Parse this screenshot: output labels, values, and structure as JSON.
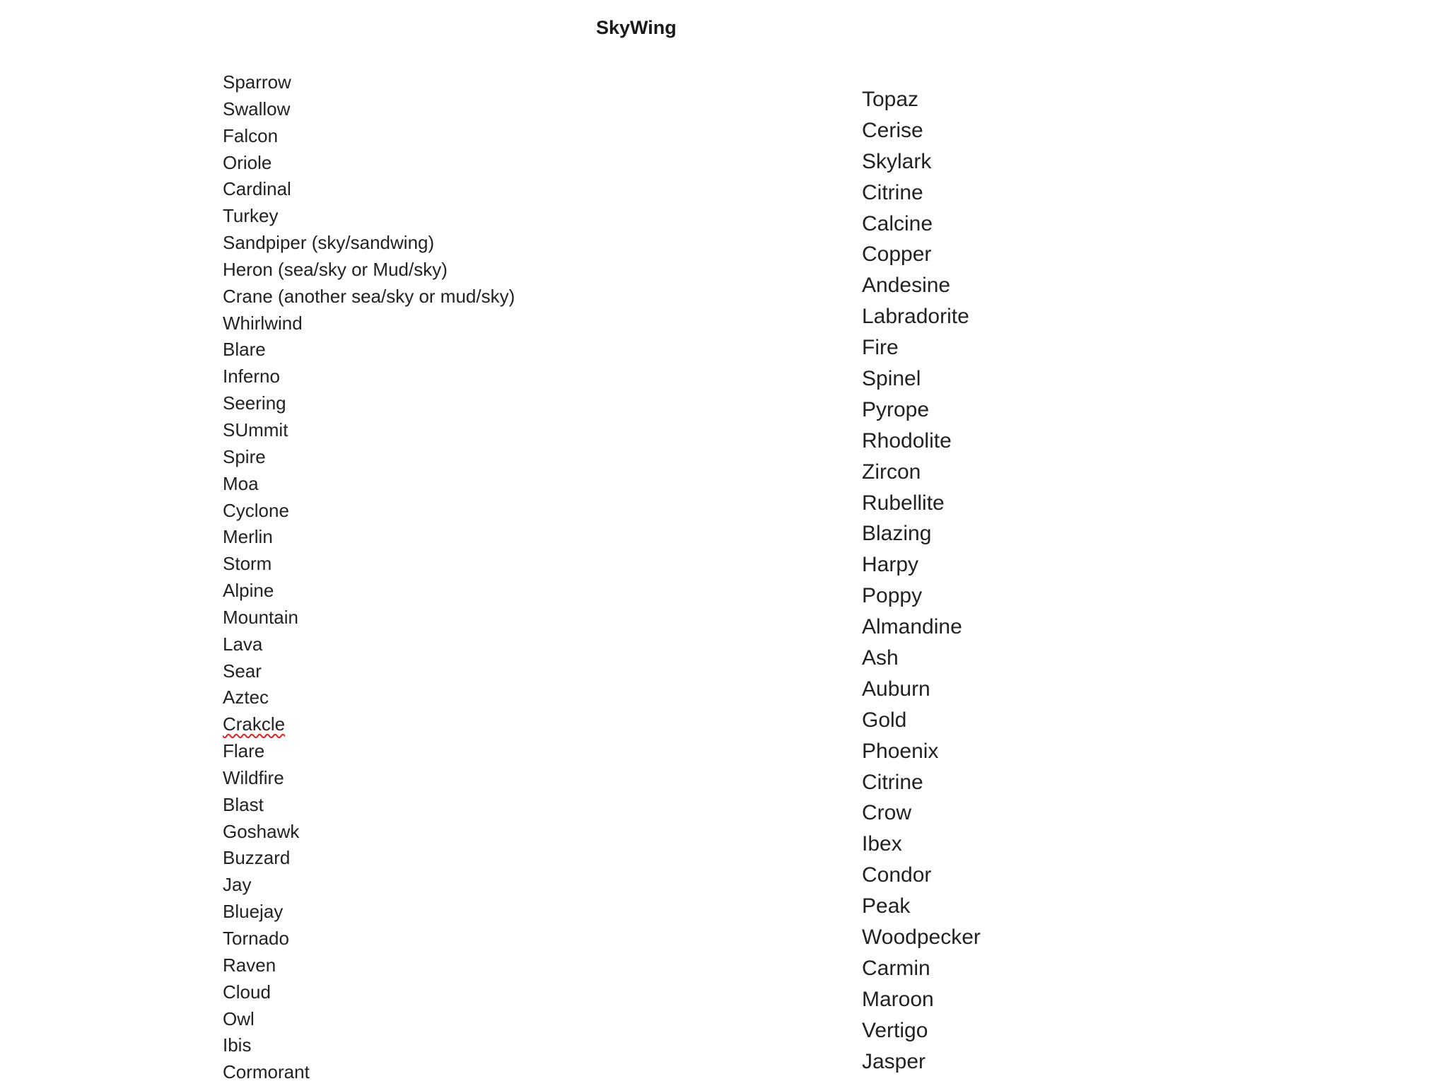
{
  "document": {
    "title": "SkyWing",
    "left_column": [
      "Sparrow",
      "Swallow",
      "Falcon",
      "Oriole",
      "Cardinal",
      "Turkey",
      "Sandpiper (sky/sandwing)",
      "Heron (sea/sky or Mud/sky)",
      "Crane (another sea/sky or mud/sky)",
      "Whirlwind",
      "Blare",
      "Inferno",
      "Seering",
      "SUmmit",
      "Spire",
      "Moa",
      "Cyclone",
      "Merlin",
      "Storm",
      "Alpine",
      "Mountain",
      "Lava",
      "Sear",
      "Aztec",
      "Crakcle",
      "Flare",
      "Wildfire",
      "Blast",
      "Goshawk",
      "Buzzard",
      "Jay",
      "Bluejay",
      "Tornado",
      "Raven",
      "Cloud",
      "Owl",
      "Ibis",
      "Cormorant"
    ],
    "right_column": [
      "Topaz",
      "Cerise",
      "Skylark",
      "Citrine",
      "Calcine",
      "Copper",
      "Andesine",
      "Labradorite",
      "Fire",
      "Spinel",
      "Pyrope",
      "Rhodolite",
      "Zircon",
      "Rubellite",
      "Blazing",
      "Harpy",
      "Poppy",
      "Almandine",
      "Ash",
      "Auburn",
      "Gold",
      "Phoenix",
      "Citrine",
      "Crow",
      "Ibex",
      "Condor",
      "Peak",
      "Woodpecker",
      "Carmin",
      "Maroon",
      "Vertigo",
      "Jasper"
    ],
    "spellcheck_flagged": [
      "Crakcle"
    ],
    "colors": {
      "text": "#222222",
      "spellcheck_underline": "#e02020",
      "background": "#ffffff"
    }
  }
}
